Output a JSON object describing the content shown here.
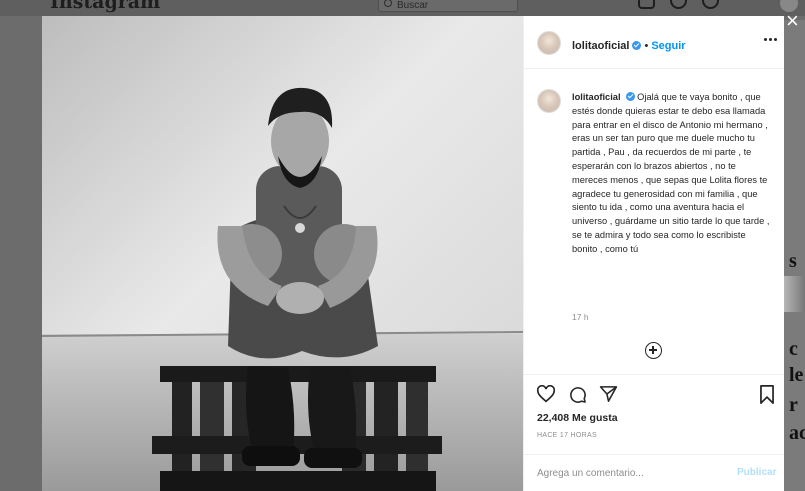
{
  "background": {
    "logo": "Instagram",
    "search_placeholder": "Buscar",
    "nav_icons": [
      "home-icon",
      "messenger-icon",
      "explore-icon",
      "activity-heart-icon"
    ],
    "side_letters": [
      "s",
      "c",
      "le",
      "r",
      "ac"
    ]
  },
  "post": {
    "username": "lolitaoficial",
    "verified": true,
    "separator": "•",
    "follow_label": "Seguir",
    "caption": "Ojalá que te vaya bonito , que estés donde quieras estar te debo esa llamada para entrar en el disco de Antonio mi hermano , eras un ser tan puro que me duele mucho tu partida , Pau , da recuerdos de mi parte , te esperarán con lo brazos abiertos , no te mereces menos , que sepas que Lolita flores te agradece tu generosidad con mi familia , que siento tu ida , como una aventura hacia el universo , guárdame un sitio tarde lo que tarde , se te admira y todo sea como lo escribiste bonito , como tú",
    "caption_time": "17 h",
    "likes": "22,408 Me gusta",
    "posted_ago": "HACE 17 HORAS",
    "comment_placeholder": "Agrega un comentario...",
    "publish_label": "Publicar"
  },
  "colors": {
    "accent": "#0095f6",
    "verified": "#3897f0",
    "publish_disabled": "#b2dffc",
    "text": "#262626",
    "muted": "#8e8e8e"
  }
}
